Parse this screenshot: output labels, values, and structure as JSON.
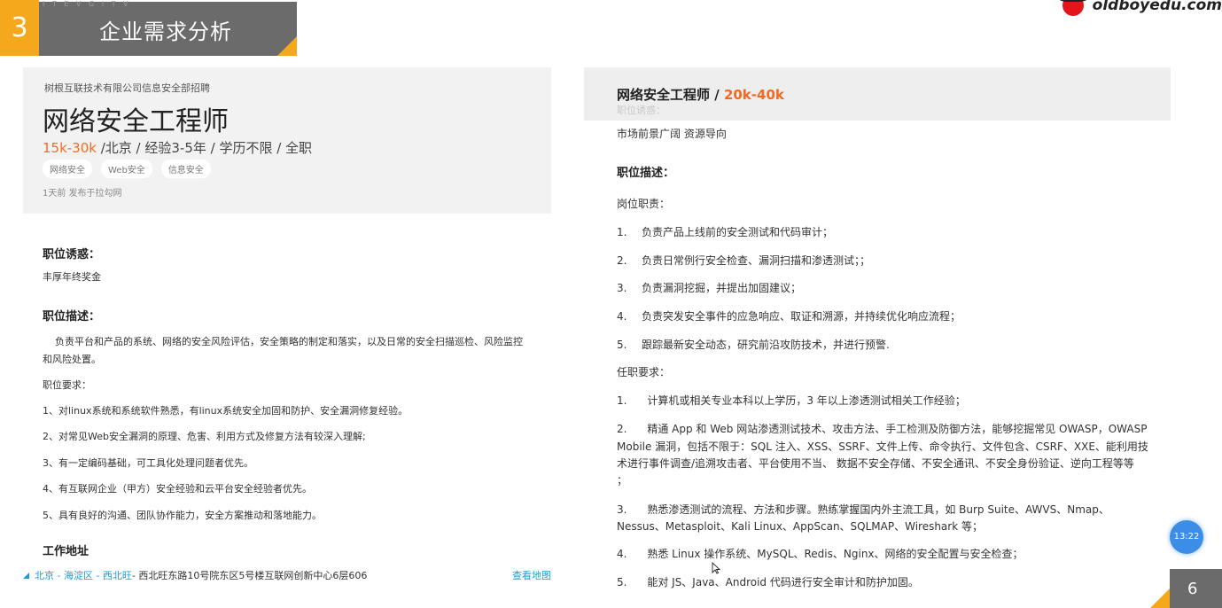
{
  "slide": {
    "number": "3",
    "title": "企业需求分析",
    "watermark": "I T E V G I T V",
    "page_number": "6",
    "timer": "13:22"
  },
  "logo": {
    "text": "oldboyedu.com",
    "icon": "oldboy-logo-icon"
  },
  "left_job": {
    "company": "树根互联技术有限公司信息安全部招聘",
    "title": "网络安全工程师",
    "salary": "15k-30k",
    "meta": " /北京 / 经验3-5年 / 学历不限 / 全职",
    "tags": [
      "网络安全",
      "Web安全",
      "信息安全"
    ],
    "posted": "1天前  发布于拉勾网",
    "benefit_heading": "职位诱惑：",
    "benefit": "丰厚年终奖金",
    "desc_heading": "职位描述：",
    "desc_line1": "    负责平台和产品的系统、网络的安全风险评估，安全策略的制定和落实，以及日常的安全扫描巡检、风险监控",
    "desc_line2": "和风险处置。",
    "req_heading": "职位要求：",
    "requirements": [
      "1、对linux系统和系统软件熟悉，有linux系统安全加固和防护、安全漏洞修复经验。",
      "2、对常见Web安全漏洞的原理、危害、利用方式及修复方法有较深入理解;",
      "3、有一定编码基础，可工具化处理问题者优先。",
      "4、有互联网企业（甲方）安全经验和云平台安全经验者优先。",
      "5、具有良好的沟通、团队协作能力，安全方案推动和落地能力。"
    ],
    "address_heading": "工作地址",
    "address_link": "北京 - 海淀区 - 西北旺",
    "address_text": " - 西北旺东路10号院东区5号楼互联网创新中心6层606",
    "map_link": "查看地图"
  },
  "right_job": {
    "title": "网络安全工程师 / ",
    "salary": "20k-40k",
    "ghost_text": "职位诱惑：",
    "benefit": "市场前景广阔 资源导向",
    "desc_heading": "职位描述：",
    "duties_heading": "岗位职责：",
    "duties": [
      {
        "n": "1.",
        "t": "负责产品上线前的安全测试和代码审计；"
      },
      {
        "n": "2.",
        "t": "负责日常例行安全检查、漏洞扫描和渗透测试；；"
      },
      {
        "n": "3.",
        "t": "负责漏洞挖掘，并提出加固建议；"
      },
      {
        "n": "4.",
        "t": "负责突发安全事件的应急响应、取证和溯源，并持续优化响应流程；"
      },
      {
        "n": "5.",
        "t": "跟踪最新安全动态，研究前沿攻防技术，并进行预警."
      }
    ],
    "req_heading": "任职要求：",
    "req1": "1.      计算机或相关专业本科以上学历，3 年以上渗透测试相关工作经验；",
    "req2_l1": "2.      精通 App 和 Web 网站渗透测试技术、攻击方法、手工检测及防御方法，能够挖掘常见 OWASP，OWASP",
    "req2_l2": "Mobile 漏洞，包括不限于：SQL 注入、XSS、SSRF、文件上传、命令执行、文件包含、CSRF、XXE、能利用技",
    "req2_l3": "术进行事件调查/追溯攻击者、平台使用不当、 数据不安全存储、不安全通讯、不安全身份验证、逆向工程等等",
    "req2_l4": "；",
    "req3_l1": "3.      熟悉渗透测试的流程、方法和步骤。熟练掌握国内外主流工具，如 Burp Suite、AWVS、Nmap、",
    "req3_l2": "Nessus、Metasploit、Kali Linux、AppScan、SQLMAP、Wireshark 等；",
    "req4": "4.      熟悉 Linux 操作系统、MySQL、Redis、Nginx、网络的安全配置与安全检查；",
    "req5": "5.      能对 JS、Java、Android 代码进行安全审计和防护加固。"
  },
  "colors": {
    "accent_orange": "#f5a81c",
    "salary_orange": "#f26a21",
    "link_blue": "#1d9cd8",
    "header_gray": "#6b6b6b"
  }
}
